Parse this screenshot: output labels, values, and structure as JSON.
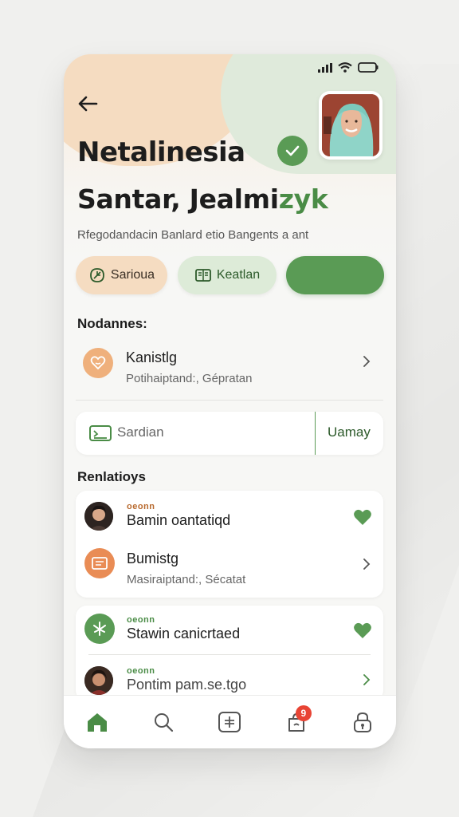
{
  "header": {
    "title": "Netalinesia",
    "subtitle_prefix": "Santar, Jealmi",
    "subtitle_accent": "zyk",
    "description": "Rfegodandacin Banlard etio Bangents a ant"
  },
  "actions": {
    "chip1_label": "Sarioua",
    "chip2_label": "Keatlan",
    "chip3_label": ""
  },
  "notifications": {
    "section_label": "Nodannes:",
    "item": {
      "title": "Kanistlg",
      "subtitle": "Potihaiptand:, Gépratan"
    }
  },
  "search": {
    "placeholder": "Sardian",
    "action_label": "Uamay"
  },
  "relations": {
    "section_label": "Renlatioys",
    "items": [
      {
        "tag": "oeonn",
        "title": "Bamin oantatiqd"
      },
      {
        "title": "Bumistg",
        "subtitle": "Masiraiptand:, Sécatat"
      },
      {
        "tag": "oeonn",
        "title": "Stawin canicrtaed"
      },
      {
        "tag": "oeonn",
        "title": "Pontim pam.se.tgo"
      }
    ]
  },
  "tabbar": {
    "badge_count": "9"
  },
  "colors": {
    "accent_green": "#5a9b55",
    "peach": "#f5dcc1",
    "light_green": "#ddebd8",
    "badge_red": "#e84434"
  }
}
